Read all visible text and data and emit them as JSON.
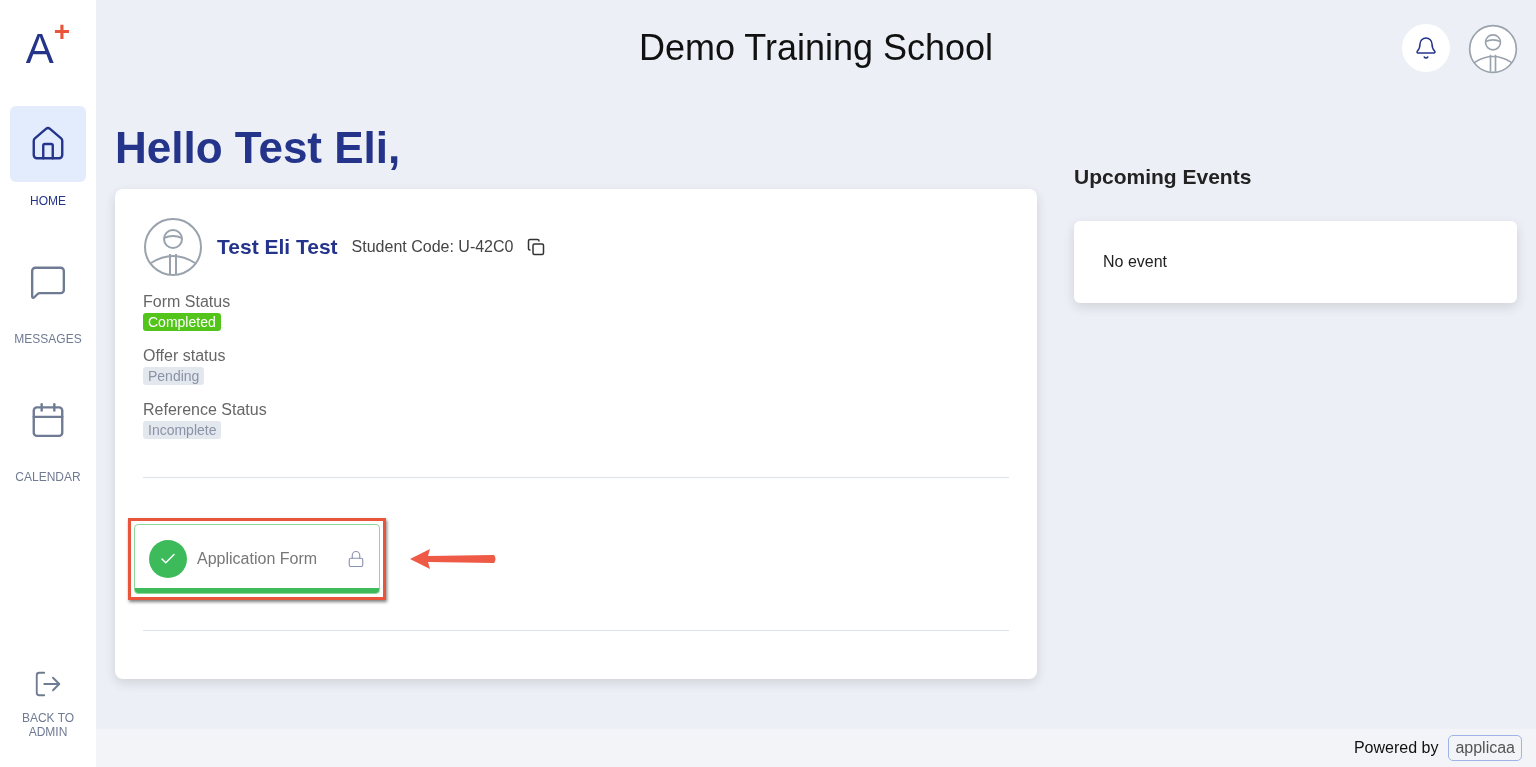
{
  "logo": {
    "letter": "A",
    "mark": "+"
  },
  "sidebar": {
    "items": [
      {
        "kind": "home",
        "label": "HOME",
        "selected": true
      },
      {
        "kind": "messages",
        "label": "MESSAGES",
        "selected": false
      },
      {
        "kind": "calendar",
        "label": "CALENDAR",
        "selected": false
      }
    ],
    "bottom_item": {
      "kind": "logout",
      "label": "BACK TO ADMIN"
    }
  },
  "header": {
    "title": "Demo Training School"
  },
  "greeting": "Hello Test Eli,",
  "student": {
    "name": "Test Eli Test",
    "code": "Student Code: U-42C0",
    "statuses": [
      {
        "label": "Form Status",
        "value": "Completed",
        "kind": "success"
      },
      {
        "label": "Offer status",
        "value": "Pending",
        "kind": "neutral"
      },
      {
        "label": "Reference Status",
        "value": "Incomplete",
        "kind": "neutral"
      }
    ],
    "forms": [
      {
        "title": "Application Form",
        "completed": true,
        "locked": true,
        "level": 1,
        "highlighted": true
      }
    ]
  },
  "events": {
    "title": "Upcoming Events",
    "empty_text": "No event"
  },
  "footer": {
    "text": "Powered by",
    "brand": "applicaa"
  }
}
